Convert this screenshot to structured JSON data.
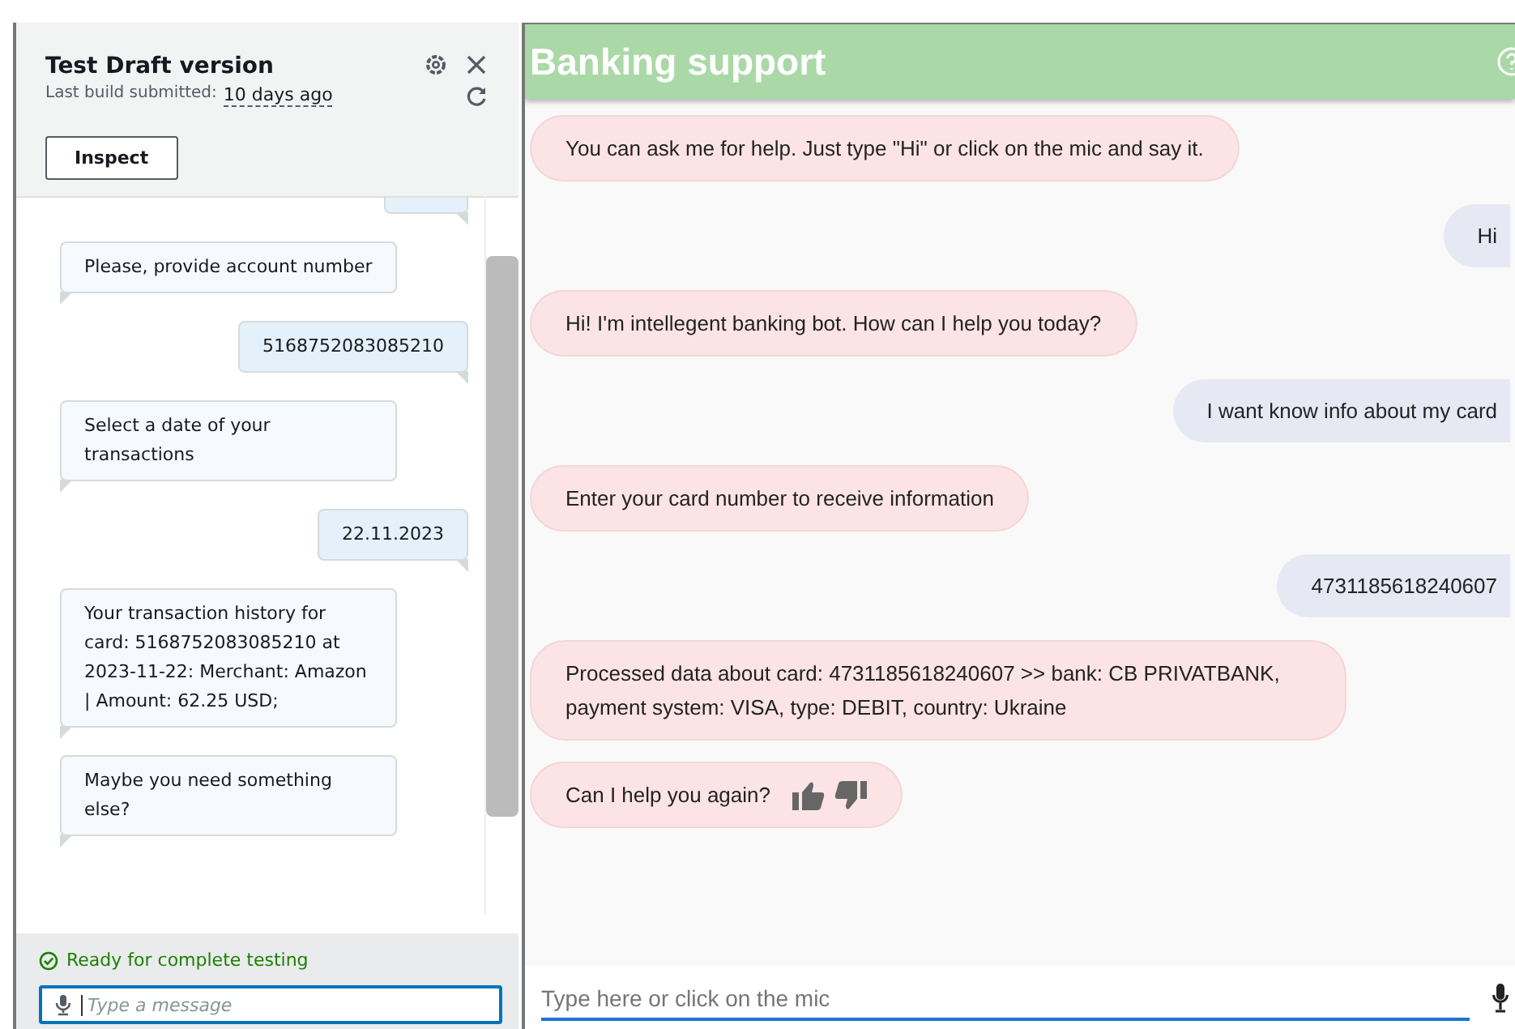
{
  "test_panel": {
    "title": "Test Draft version",
    "build_label": "Last build submitted:",
    "build_age": "10 days ago",
    "inspect_button": "Inspect",
    "messages": [
      {
        "kind": "cut"
      },
      {
        "kind": "bot",
        "text": "Please, provide account number"
      },
      {
        "kind": "user",
        "text": "5168752083085210"
      },
      {
        "kind": "bot",
        "text": "Select a date of your transactions"
      },
      {
        "kind": "user",
        "text": "22.11.2023"
      },
      {
        "kind": "bot",
        "text": "Your transaction history for card: 5168752083085210 at 2023-11-22: Merchant: Amazon | Amount: 62.25 USD;"
      },
      {
        "kind": "bot",
        "text": "Maybe you need something else?"
      }
    ],
    "status": "Ready for complete testing",
    "input": {
      "placeholder": "Type a message"
    }
  },
  "bot_window": {
    "title": "Banking support",
    "messages": [
      {
        "kind": "bot",
        "text": "You can ask me for help. Just type \"Hi\" or click on the mic and say it.",
        "feedback": false
      },
      {
        "kind": "user",
        "text": "Hi",
        "feedback": false
      },
      {
        "kind": "bot",
        "text": "Hi! I'm intellegent banking bot. How can I help you today?",
        "feedback": false
      },
      {
        "kind": "user",
        "text": "I want know info about my card",
        "feedback": false
      },
      {
        "kind": "bot",
        "text": "Enter your card number to receive information",
        "feedback": false
      },
      {
        "kind": "user",
        "text": "4731185618240607",
        "feedback": false
      },
      {
        "kind": "bot",
        "text": "Processed data about card: 4731185618240607 >> bank: CB PRIVATBANK, payment system: VISA, type: DEBIT, country: Ukraine",
        "feedback": false
      },
      {
        "kind": "bot",
        "text": "Can I help you again?",
        "feedback": true
      }
    ],
    "input": {
      "placeholder": "Type here or click on the mic"
    }
  }
}
